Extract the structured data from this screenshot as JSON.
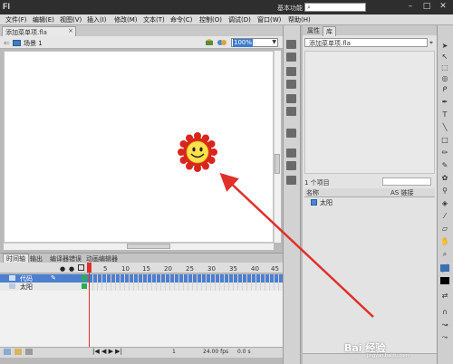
{
  "app": {
    "logo": "Fl",
    "workspace": "基本功能",
    "window_controls": [
      "–",
      "□",
      "✕"
    ]
  },
  "menu": [
    "文件(F)",
    "编辑(E)",
    "视图(V)",
    "插入(I)",
    "修改(M)",
    "文本(T)",
    "命令(C)",
    "控制(O)",
    "调试(D)",
    "窗口(W)",
    "帮助(H)"
  ],
  "document": {
    "tab_label": "添加菜单项.fla",
    "tab_close": "×"
  },
  "scene": {
    "label": "场景 1",
    "zoom": "100%"
  },
  "timeline": {
    "tabs": [
      "时间轴",
      "输出",
      "编译器错误",
      "动画编辑器"
    ],
    "frame_numbers": [
      "5",
      "10",
      "15",
      "20",
      "25",
      "30",
      "35",
      "40",
      "45"
    ],
    "layers": [
      {
        "name": "代码"
      },
      {
        "name": "太阳"
      }
    ],
    "fps": "24.00 fps",
    "time": "0.0 s",
    "frame": "1"
  },
  "library": {
    "tabs": [
      "属性",
      "库"
    ],
    "document": "添加菜单项.fla",
    "count": "1 个项目",
    "col_name": "名称",
    "col_linkage": "AS 链接",
    "items": [
      {
        "name": "太阳"
      }
    ]
  },
  "watermark": {
    "text": "Bai 经验",
    "sub": "jingyan.baidu.com"
  },
  "colors": {
    "accent": "#3d7bd0",
    "arrow": "#e0302a",
    "sun_petals": "#d9261c",
    "sun_face": "#ffe14d"
  }
}
